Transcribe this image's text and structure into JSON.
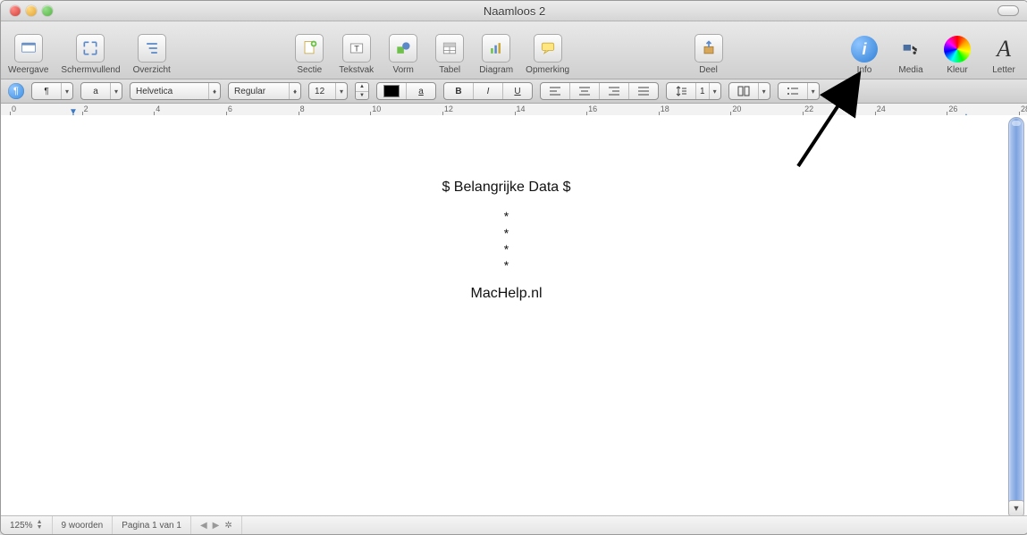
{
  "window": {
    "title": "Naamloos 2"
  },
  "toolbar": {
    "left": [
      {
        "id": "weergave",
        "label": "Weergave"
      },
      {
        "id": "schermvullend",
        "label": "Schermvullend"
      },
      {
        "id": "overzicht",
        "label": "Overzicht"
      }
    ],
    "mid": [
      {
        "id": "sectie",
        "label": "Sectie"
      },
      {
        "id": "tekstvak",
        "label": "Tekstvak"
      },
      {
        "id": "vorm",
        "label": "Vorm"
      },
      {
        "id": "tabel",
        "label": "Tabel"
      },
      {
        "id": "diagram",
        "label": "Diagram"
      },
      {
        "id": "opmerking",
        "label": "Opmerking"
      }
    ],
    "share": {
      "id": "deel",
      "label": "Deel"
    },
    "right": [
      {
        "id": "info",
        "label": "Info"
      },
      {
        "id": "media",
        "label": "Media"
      },
      {
        "id": "kleur",
        "label": "Kleur"
      },
      {
        "id": "letter",
        "label": "Letter"
      }
    ]
  },
  "format": {
    "paragraph_symbol": "¶",
    "list_symbol": "a",
    "font": "Helvetica",
    "style": "Regular",
    "size": "12",
    "color": "#000000",
    "text_btn": "a",
    "bold": "B",
    "italic": "I",
    "underline": "U",
    "spacing": "1"
  },
  "ruler": {
    "labels": [
      "0",
      "2",
      "4",
      "6",
      "8",
      "10",
      "12",
      "14",
      "16",
      "18",
      "20",
      "22",
      "24",
      "26",
      "28"
    ]
  },
  "document": {
    "title_line": "$ Belangrijke Data $",
    "bullets": [
      "*",
      "*",
      "*",
      "*"
    ],
    "footer": "MacHelp.nl"
  },
  "status": {
    "zoom": "125%",
    "words": "9 woorden",
    "page": "Pagina 1 van 1"
  }
}
